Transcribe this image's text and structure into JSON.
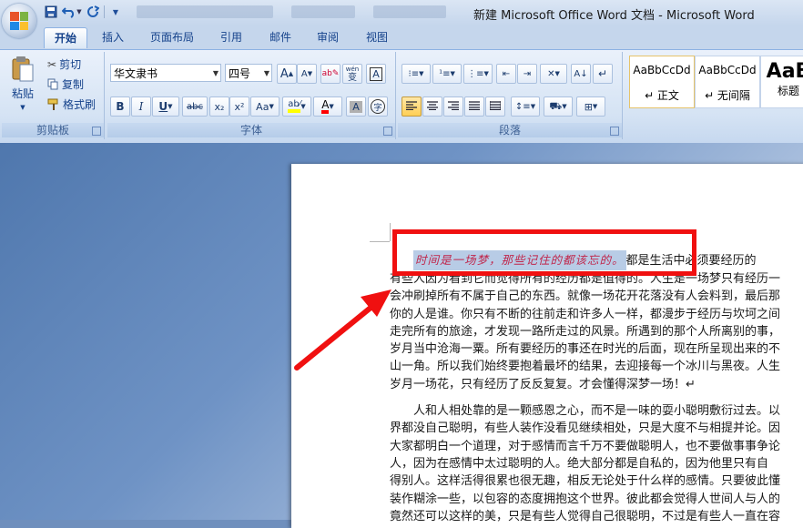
{
  "window": {
    "title": "新建 Microsoft Office Word 文档 - Microsoft Word"
  },
  "quick_access": {
    "icons": [
      "save-icon",
      "undo-icon",
      "redo-icon",
      "customize-icon"
    ]
  },
  "ribbon": {
    "tabs": [
      "开始",
      "插入",
      "页面布局",
      "引用",
      "邮件",
      "审阅",
      "视图"
    ],
    "active_tab": "开始",
    "clipboard": {
      "group_label": "剪贴板",
      "paste": "粘贴",
      "cut": "剪切",
      "copy": "复制",
      "format_painter": "格式刷"
    },
    "font": {
      "group_label": "字体",
      "font_name": "华文隶书",
      "font_size": "四号",
      "bold": "B",
      "italic": "I",
      "underline": "U",
      "strike": "abc",
      "subscript": "x₂",
      "superscript": "x²",
      "change_case": "Aa",
      "grow": "A",
      "shrink": "A",
      "phonetic": "wén",
      "phonetic_char": "变",
      "border_char": "A",
      "shade_char": "A",
      "enclose_char": "字",
      "highlight_color": "#ffff00",
      "font_color": "#ff0000"
    },
    "paragraph": {
      "group_label": "段落"
    },
    "styles": {
      "items": [
        {
          "sample": "AaBbCcDd",
          "name": "↵ 正文"
        },
        {
          "sample": "AaBbCcDd",
          "name": "↵ 无间隔"
        },
        {
          "sample": "AaB",
          "name": "标题"
        }
      ]
    }
  },
  "document": {
    "highlighted_text": "时间是一场梦，那些记住的都该忘的。",
    "lines": [
      "都是生活中必须要经历的",
      "有些人因为看到它而觉得所有的经历都是值得的。人生是一场梦只有经历一",
      "会冲刷掉所有不属于自己的东西。就像一场花开花落没有人会料到，最后那",
      "你的人是谁。你只有不断的往前走和许多人一样，都漫步于经历与坎坷之间",
      "走完所有的旅途，才发现一路所走过的风景。所遇到的那个人所离别的事，",
      "岁月当中沧海一粟。所有要经历的事还在时光的后面，现在所呈现出来的不",
      "山一角。所以我们始终要抱着最坏的结果，去迎接每一个冰川与黑夜。人生",
      "岁月一场花，只有经历了反反复复。才会懂得深梦一场！↵"
    ],
    "para2": [
      "人和人相处靠的是一颗感恩之心，而不是一味的耍小聪明敷衍过去。以",
      "界都没自己聪明，有些人装作没看见继续相处，只是大度不与相提并论。因",
      "大家都明白一个道理，对于感情而言千万不要做聪明人，也不要做事事争论",
      "人，因为在感情中太过聪明的人。绝大部分都是自私的，因为他里只有自",
      "得别人。这样活得很累也很无趣，相反无论处于什么样的感情。只要彼此懂",
      "装作糊涂一些，以包容的态度拥抱这个世界。彼此都会觉得人世间人与人的",
      "竟然还可以这样的美，只是有些人觉得自己很聪明，不过是有些人一直在容"
    ]
  },
  "colors": {
    "annotation_red": "#f01010",
    "highlight_text": "#c0264b",
    "selection": "#b8cce6"
  }
}
